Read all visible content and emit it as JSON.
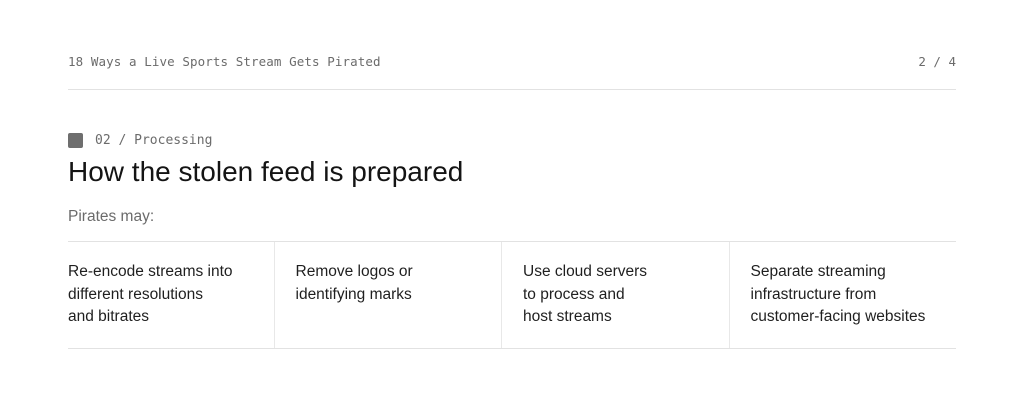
{
  "header": {
    "doc_title": "18 Ways a Live Sports Stream Gets Pirated",
    "page_indicator": "2 / 4"
  },
  "section": {
    "icon": "square-icon",
    "label": "02 / Processing",
    "heading": "How the stolen feed is prepared",
    "intro": "Pirates may:"
  },
  "cards": [
    {
      "lines": [
        "Re-encode streams into",
        "different resolutions",
        "and bitrates"
      ]
    },
    {
      "lines": [
        "Remove logos or",
        "identifying marks"
      ]
    },
    {
      "lines": [
        "Use cloud servers",
        "to process and",
        "host streams"
      ]
    },
    {
      "lines": [
        "Separate streaming",
        "infrastructure from",
        "customer-facing websites"
      ]
    }
  ],
  "colors": {
    "text": "#1a1a1a",
    "muted": "#6b6b6b",
    "divider": "#e2e2e2",
    "icon": "#6e6e6e"
  }
}
